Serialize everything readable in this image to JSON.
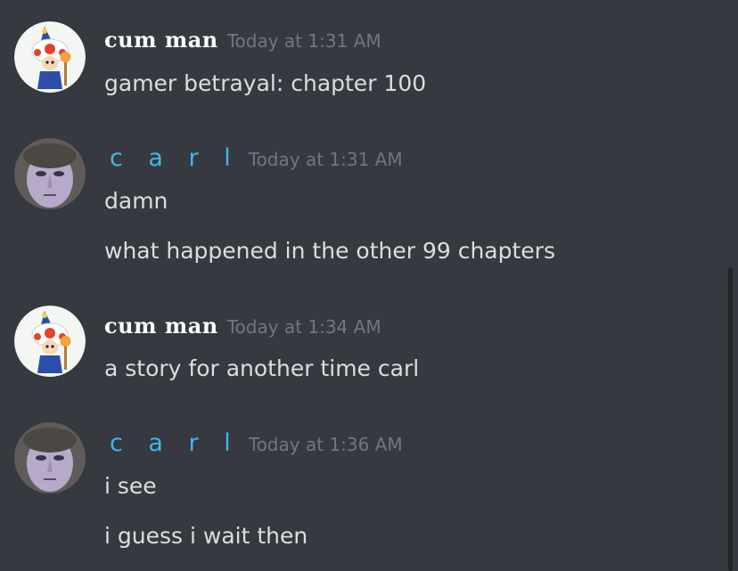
{
  "colors": {
    "background": "#36393f",
    "username_primary": "#ffffff",
    "username_carl": "#3fb6ee",
    "timestamp": "#72767d",
    "message_text": "#dcddde"
  },
  "messages": [
    {
      "author": "cum man",
      "avatar": "toad-avatar-icon",
      "timestamp": "Today at 1:31 AM",
      "lines": [
        "gamer betrayal: chapter 100"
      ]
    },
    {
      "author": "c a r l",
      "avatar": "carl-avatar-icon",
      "timestamp": "Today at 1:31 AM",
      "lines": [
        "damn",
        "what happened in the other 99 chapters"
      ]
    },
    {
      "author": "cum man",
      "avatar": "toad-avatar-icon",
      "timestamp": "Today at 1:34 AM",
      "lines": [
        "a story for another time carl"
      ]
    },
    {
      "author": "c a r l",
      "avatar": "carl-avatar-icon",
      "timestamp": "Today at 1:36 AM",
      "lines": [
        "i see",
        "i guess i wait then"
      ]
    }
  ]
}
